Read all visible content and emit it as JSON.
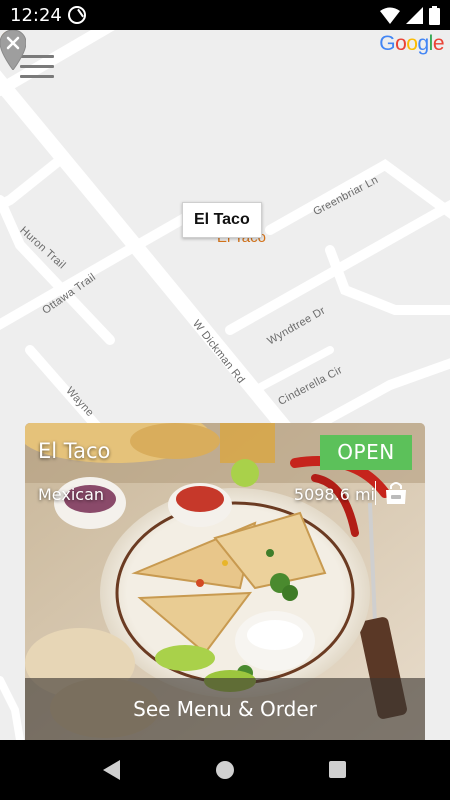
{
  "status_bar": {
    "time": "12:24",
    "icons": [
      "at-sign-icon",
      "wifi-icon",
      "signal-icon",
      "battery-icon"
    ]
  },
  "map": {
    "attribution": "Google",
    "road_labels": [
      "Greenbriar Ln",
      "Huron Trail",
      "Ottawa Trail",
      "W Dickman Rd",
      "Wyndtree Dr",
      "Cinderella Cir",
      "Wayne"
    ],
    "marker": {
      "callout_title": "El Taco",
      "place_label": "El Taco"
    }
  },
  "restaurant_card": {
    "name": "El Taco",
    "status": "OPEN",
    "category": "Mexican",
    "distance": "5098.6 mi",
    "action_label": "See Menu & Order"
  },
  "colors": {
    "open_badge": "#5cc15a",
    "place_label": "#d4731b",
    "marker_pin": "#f29418",
    "google_blue": "#4285f4",
    "google_red": "#ea4335",
    "google_yellow": "#fbbc05",
    "google_green": "#34a853"
  },
  "nav_bar": {
    "buttons": [
      "back",
      "home",
      "recents"
    ]
  }
}
